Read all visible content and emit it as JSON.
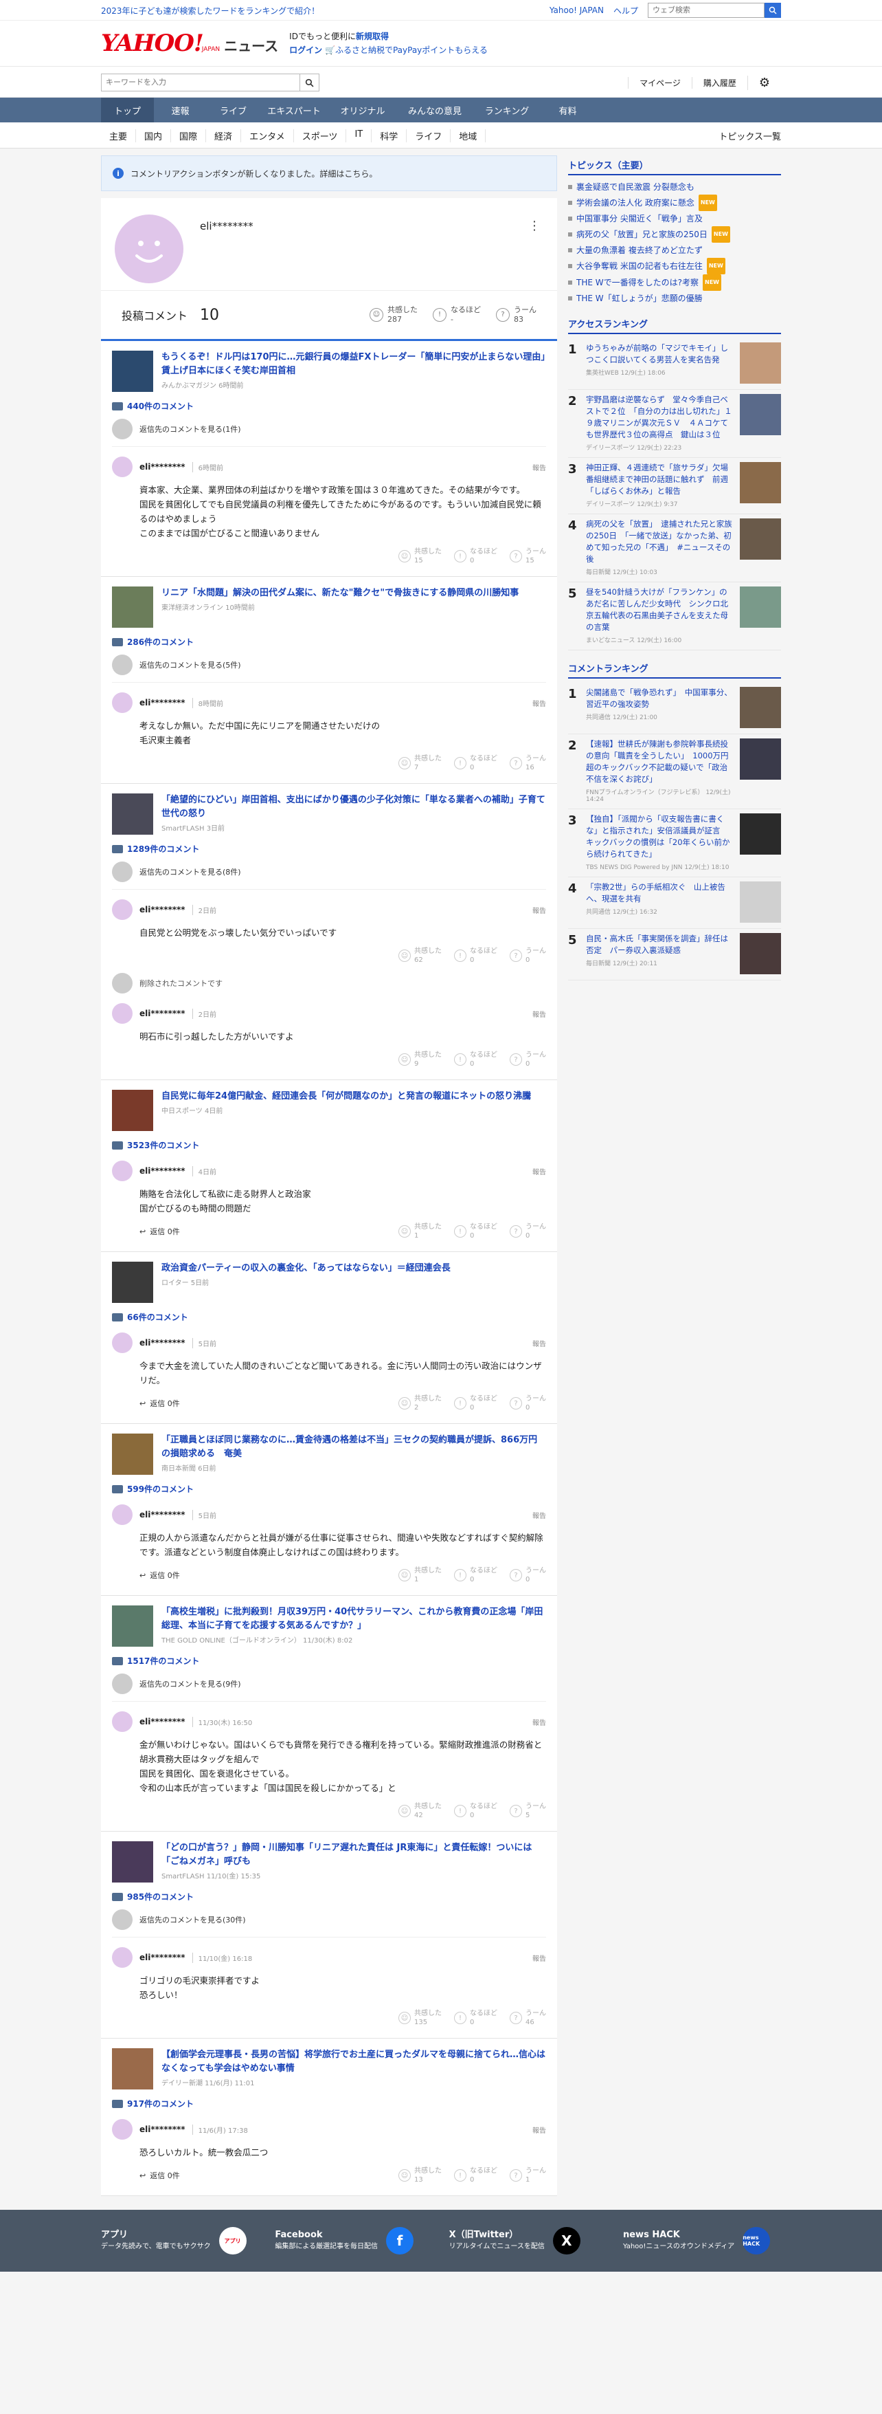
{
  "top": {
    "promo": "2023年に子ども達が検索したワードをランキングで紹介！",
    "links": [
      "Yahoo! JAPAN",
      "ヘルプ"
    ],
    "search_placeholder": "ウェブ検索"
  },
  "header": {
    "logo": "YAHOO!",
    "logo_sub": "JAPAN",
    "section": "ニュース",
    "promo_line1_a": "IDでもっと便利に",
    "promo_line1_b": "新規取得",
    "promo_line2_a": "ログイン",
    "promo_line2_b": "ふるさと納税でPayPayポイントもらえる"
  },
  "searchbar": {
    "placeholder": "キーワードを入力",
    "mypage": "マイページ",
    "history": "購入履歴"
  },
  "nav": [
    "トップ",
    "速報",
    "ライブ",
    "エキスパート",
    "オリジナル",
    "みんなの意見",
    "ランキング",
    "有料"
  ],
  "subnav": {
    "cats": [
      "主要",
      "国内",
      "国際",
      "経済",
      "エンタメ",
      "スポーツ",
      "IT",
      "科学",
      "ライフ",
      "地域"
    ],
    "list": "トピックス一覧"
  },
  "notice": "コメントリアクションボタンが新しくなりました。詳細はこちら。",
  "profile": {
    "username": "eli********",
    "posts_label": "投稿コメント",
    "posts_count": "10",
    "reactions": [
      {
        "label": "共感した",
        "value": "287"
      },
      {
        "label": "なるほど",
        "value": "-"
      },
      {
        "label": "うーん",
        "value": "83"
      }
    ]
  },
  "labels": {
    "reply": "返信",
    "report": "報告",
    "kyokan": "共感した",
    "naruhodo": "なるほど",
    "uun": "うーん"
  },
  "comments": [
    {
      "title": "もうくるぞ！ドル円は170円に…元銀行員の爆益FXトレーダー「簡単に円安が止まらない理由」賃上げ日本にほくそ笑む岸田首相",
      "source": "みんかぶマガジン 6時間前",
      "count": "440件のコメント",
      "replyto": "返信先のコメントを見る(1件)",
      "user": "eli********",
      "time": "6時間前",
      "text": [
        "資本家、大企業、業界団体の利益ばかりを増やす政策を国は３０年進めてきた。その結果が今です。",
        "国民を貧困化してでも自民党議員の利権を優先してきたために今があるのです。もういい加減自民党に頼るのはやめましょう",
        "このままでは国が亡びること間違いありません"
      ],
      "reply": "",
      "r": [
        "15",
        "0",
        "15"
      ]
    },
    {
      "title": "リニア「水問題」解決の田代ダム案に、新たな\"難クセ\"で骨抜きにする静岡県の川勝知事",
      "source": "東洋経済オンライン 10時間前",
      "count": "286件のコメント",
      "replyto": "返信先のコメントを見る(5件)",
      "user": "eli********",
      "time": "8時間前",
      "text": [
        "考えなしか無い。ただ中国に先にリニアを開通させたいだけの",
        "毛沢東主義者"
      ],
      "reply": "",
      "r": [
        "7",
        "0",
        "16"
      ]
    },
    {
      "title": "「絶望的にひどい」岸田首相、支出にばかり優遇の少子化対策に「単なる業者への補助」子育て世代の怒り",
      "source": "SmartFLASH 3日前",
      "count": "1289件のコメント",
      "replyto": "返信先のコメントを見る(8件)",
      "user": "eli********",
      "time": "2日前",
      "text": [
        "自民党と公明党をぶっ壊したい気分でいっぱいです"
      ],
      "reply": "",
      "r": [
        "62",
        "0",
        "0"
      ],
      "deleted": "削除されたコメントです",
      "user2": "eli********",
      "time2": "2日前",
      "text2": [
        "明石市に引っ越したした方がいいですよ"
      ],
      "r2": [
        "9",
        "0",
        "0"
      ]
    },
    {
      "title": "自民党に毎年24億円献金、経団連会長「何が問題なのか」と発言の報道にネットの怒り沸騰",
      "source": "中日スポーツ 4日前",
      "count": "3523件のコメント",
      "replyto": "",
      "user": "eli********",
      "time": "4日前",
      "text": [
        "賄賂を合法化して私欲に走る財界人と政治家",
        "国が亡びるのも時間の問題だ"
      ],
      "reply": "返信 0件",
      "r": [
        "1",
        "0",
        "0"
      ]
    },
    {
      "title": "政治資金パーティーの収入の裏金化、「あってはならない」＝経団連会長",
      "source": "ロイター 5日前",
      "count": "66件のコメント",
      "replyto": "",
      "user": "eli********",
      "time": "5日前",
      "text": [
        "今まで大金を流していた人間のきれいごとなど聞いてあきれる。金に汚い人間同士の汚い政治にはウンザリだ。"
      ],
      "reply": "返信 0件",
      "r": [
        "2",
        "0",
        "0"
      ]
    },
    {
      "title": "「正職員とほぼ同じ業務なのに…賃金待遇の格差は不当」三セクの契約職員が提訴、866万円の損賠求める　奄美",
      "source": "南日本新聞 6日前",
      "count": "599件のコメント",
      "replyto": "",
      "user": "eli********",
      "time": "5日前",
      "text": [
        "正規の人から派遣なんだからと社員が嫌がる仕事に従事させられ、間違いや失敗などすればすぐ契約解除です。派遣などという制度自体廃止しなければこの国は終わります。"
      ],
      "reply": "返信 0件",
      "r": [
        "1",
        "0",
        "0"
      ]
    },
    {
      "title": "「高校生増税」に批判殺到！月収39万円・40代サラリーマン、これから教育費の正念場「岸田総理、本当に子育てを応援する気あるんですか？」",
      "source": "THE GOLD ONLINE（ゴールドオンライン） 11/30(木) 8:02",
      "count": "1517件のコメント",
      "replyto": "返信先のコメントを見る(9件)",
      "user": "eli********",
      "time": "11/30(木) 16:50",
      "text": [
        "金が無いわけじゃない。国はいくらでも貨幣を発行できる権利を持っている。緊縮財政推進派の財務省と胡氷貫務大臣はタッグを組んで",
        "国民を貧困化、国を衰退化させている。",
        "令和の山本氏が言っていますよ「国は国民を殺しにかかってる」と"
      ],
      "reply": "",
      "r": [
        "42",
        "0",
        "5"
      ]
    },
    {
      "title": "「どの口が言う？」静岡・川勝知事「リニア遅れた責任は JR東海に」と責任転嫁！ついには「ごねメガネ」呼びも",
      "source": "SmartFLASH 11/10(金) 15:35",
      "count": "985件のコメント",
      "replyto": "返信先のコメントを見る(30件)",
      "user": "eli********",
      "time": "11/10(金) 16:18",
      "text": [
        "ゴリゴリの毛沢東崇拝者ですよ",
        "恐ろしい！"
      ],
      "reply": "",
      "r": [
        "135",
        "0",
        "46"
      ]
    },
    {
      "title": "【創価学会元理事長・長男の苦悩】将学旅行でお土産に買ったダルマを母親に捨てられ…信心はなくなっても学会はやめない事情",
      "source": "デイリー新潮 11/6(月) 11:01",
      "count": "917件のコメント",
      "replyto": "",
      "user": "eli********",
      "time": "11/6(月) 17:38",
      "text": [
        "恐ろしいカルト。統一教会瓜二つ"
      ],
      "reply": "返信 0件",
      "r": [
        "13",
        "0",
        "1"
      ]
    }
  ],
  "sidebar": {
    "topics_title": "トピックス（主要）",
    "topics": [
      {
        "t": "裏金疑惑で自民激震 分裂懸念も",
        "new": false
      },
      {
        "t": "学術会議の法人化 政府案に懸念",
        "new": true
      },
      {
        "t": "中国軍事分 尖閣近く「戦争」言及",
        "new": false
      },
      {
        "t": "病死の父「放置」兄と家族の250日",
        "new": true
      },
      {
        "t": "大量の魚漂着 複去終了めど立たず",
        "new": false
      },
      {
        "t": "大谷争奪戦 米国の記者も右往左往",
        "new": true
      },
      {
        "t": "THE Wで一番得をしたのは?考察",
        "new": true
      },
      {
        "t": "THE W「虹しょうが」悲願の優勝",
        "new": false
      }
    ],
    "access_title": "アクセスランキング",
    "access": [
      {
        "n": "1",
        "t": "ゆうちゃみが前略の「マジでキモイ」しつこく口説いてくる男芸人を実名告発",
        "m": "集英社WEB 12/9(土) 18:06"
      },
      {
        "n": "2",
        "t": "宇野昌磨は逆襲ならず　堂々今季自己ベストで２位　「自分の力は出し切れた」１９歳マリニンが異次元ＳＶ　４Ａコケても世界歴代３位の高得点　鍵山は３位",
        "m": "デイリースポーツ 12/9(土) 22:23"
      },
      {
        "n": "3",
        "t": "神田正輝、４週連続で「旅サラダ」欠場　番組継続まで神田の話題に触れず　前週「しばらくお休み」と報告",
        "m": "デイリースポーツ 12/9(土) 9:37"
      },
      {
        "n": "4",
        "t": "病死の父を「放置」　逮捕された兄と家族の250日　「一緒で放送」なかった弟、初めて知った兄の「不遇」　#ニュースその後",
        "m": "毎日新聞 12/9(土) 10:03"
      },
      {
        "n": "5",
        "t": "昼を540針縫う大けが「フランケン」のあだ名に苦しんだ少女時代　シンクロ北京五輪代表の石黒由美子さんを支えた母の言葉",
        "m": "まいどなニュース 12/9(土) 16:00"
      }
    ],
    "comment_title": "コメントランキング",
    "commentrank": [
      {
        "n": "1",
        "t": "尖閣諸島で「戦争恐れず」　中国軍事分、習近平の強攻姿勢",
        "m": "共同通信 12/9(土) 21:00"
      },
      {
        "n": "2",
        "t": "【速報】世耕氏が陳謝も参院幹事長続投の意向「職責を全うしたい」　1000万円超のキックバック不記載の疑いで「政治不信を深くお詫び」",
        "m": "FNNプライムオンライン（フジテレビ系） 12/9(土) 14:24"
      },
      {
        "n": "3",
        "t": "【独自】「派閥から「収支報告書に書くな」と指示された」安倍派議員が証言　キックバックの慣例は「20年くらい前から続けられてきた」",
        "m": "TBS NEWS DIG Powered by JNN 12/9(土) 18:10"
      },
      {
        "n": "4",
        "t": "「宗教2世」らの手紙相次ぐ　山上被告へ、現選を共有",
        "m": "共同通信 12/9(土) 16:32"
      },
      {
        "n": "5",
        "t": "自民・高木氏「事実関係を調査」辞任は否定　パー券収入裏派疑惑",
        "m": "毎日新聞 12/9(土) 20:11"
      }
    ]
  },
  "footer": [
    {
      "title": "アプリ",
      "desc": "データ先読みで、電車でもサクサク",
      "icon": "アプリ"
    },
    {
      "title": "Facebook",
      "desc": "編集部による厳選記事を毎日配信",
      "icon": "f"
    },
    {
      "title": "X（旧Twitter）",
      "desc": "リアルタイムでニュースを配信",
      "icon": "X"
    },
    {
      "title": "news HACK",
      "desc": "Yahoo!ニュースのオウンドメディア",
      "icon": "news HACK"
    }
  ],
  "colors": {
    "accent": "#2e6ed8",
    "nav": "#4f6b8e",
    "link": "#1a44b8",
    "avatar": "#e0c6ea"
  }
}
